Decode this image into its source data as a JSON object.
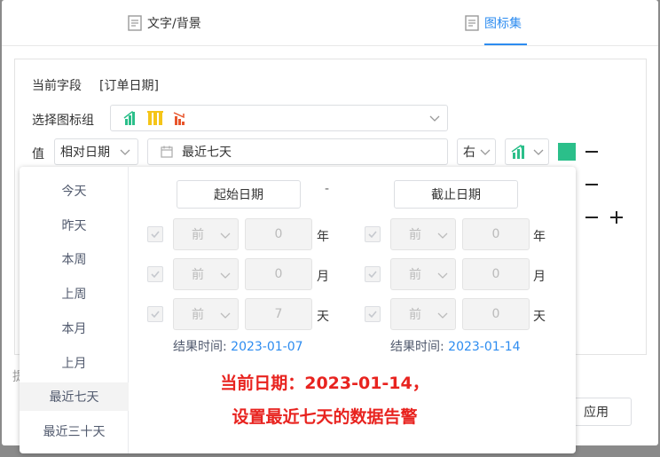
{
  "tabs": [
    {
      "label": "文字/背景",
      "active": false
    },
    {
      "label": "图标集",
      "active": true
    }
  ],
  "form": {
    "current_field_label": "当前字段",
    "current_field_value": "[订单日期]",
    "icon_group_label": "选择图标组",
    "value_label": "值",
    "value_type_select": "相对日期",
    "date_range_value": "最近七天",
    "position_select": "右",
    "color": "#2bbf8a"
  },
  "popup": {
    "shortcuts": [
      "今天",
      "昨天",
      "本周",
      "上周",
      "本月",
      "上月",
      "最近七天",
      "最近三十天"
    ],
    "active_shortcut": "最近七天",
    "start_button": "起始日期",
    "end_button": "截止日期",
    "separator": "-",
    "start_rows": [
      {
        "direction": "前",
        "value": "0",
        "unit": "年"
      },
      {
        "direction": "前",
        "value": "0",
        "unit": "月"
      },
      {
        "direction": "前",
        "value": "7",
        "unit": "天"
      }
    ],
    "end_rows": [
      {
        "direction": "前",
        "value": "0",
        "unit": "年"
      },
      {
        "direction": "前",
        "value": "0",
        "unit": "月"
      },
      {
        "direction": "前",
        "value": "0",
        "unit": "天"
      }
    ],
    "result_label": "结果时间:",
    "start_result": "2023-01-07",
    "end_result": "2023-01-14"
  },
  "annotation": {
    "line1": "当前日期：2023-01-14，",
    "line2": "设置最近七天的数据告警"
  },
  "footer": {
    "apply_label": "应用",
    "stub_text": "提"
  }
}
